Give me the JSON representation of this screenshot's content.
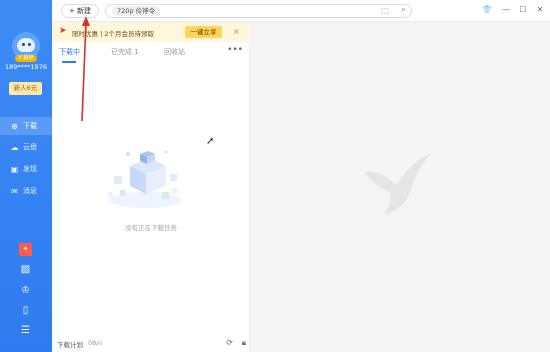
{
  "sidebar": {
    "vip_badge": "V 超级",
    "phone": "189****1976",
    "new_user_label": "新人6元",
    "items": [
      {
        "label": "下载",
        "icon": "download-icon"
      },
      {
        "label": "云盘",
        "icon": "cloud-icon"
      },
      {
        "label": "发现",
        "icon": "discover-icon"
      },
      {
        "label": "消息",
        "icon": "message-icon"
      }
    ],
    "bottom_icons": [
      "gift-icon",
      "image-icon",
      "crown-icon",
      "tablet-icon",
      "menu-icon"
    ]
  },
  "topbar": {
    "new_label": "+ 新建",
    "search_chip": "720p 伶神令",
    "icons": [
      "folder-icon",
      "search-icon",
      "shirt-icon",
      "minimize-icon",
      "maximize-icon",
      "close-icon"
    ]
  },
  "promo": {
    "text": "限时优惠 | 2个月会员待领取",
    "button": "一键立享",
    "close": "×"
  },
  "panel": {
    "tabs": [
      {
        "label": "下载中",
        "active": true
      },
      {
        "label": "已完成 1",
        "active": false
      },
      {
        "label": "回收站",
        "active": false
      }
    ],
    "more": "•••",
    "empty_text": "没有正在下载任务",
    "footer": {
      "label": "下载计划",
      "value": "08/⁄₄"
    }
  },
  "colors": {
    "sidebar": "#2f7cf0",
    "accent": "#2f7cf0",
    "promo_bg": "#fff7dc",
    "promo_btn": "#ffd45a",
    "annotation": "#d62f2f"
  }
}
